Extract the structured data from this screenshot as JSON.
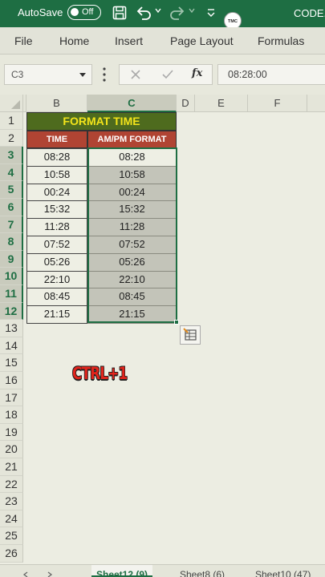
{
  "titlebar": {
    "autosave_label": "AutoSave",
    "autosave_state": "Off",
    "logo_text": "TMC",
    "file_name": "CODE.x"
  },
  "ribbon": {
    "tabs": [
      "File",
      "Home",
      "Insert",
      "Page Layout",
      "Formulas"
    ]
  },
  "formula_bar": {
    "name_box": "C3",
    "fx": "fx",
    "formula": "08:28:00"
  },
  "columns": [
    "B",
    "C",
    "D",
    "E",
    "F"
  ],
  "rows": [
    "1",
    "2",
    "3",
    "4",
    "5",
    "6",
    "7",
    "8",
    "9",
    "10",
    "11",
    "12",
    "13",
    "14",
    "15",
    "16",
    "17",
    "18",
    "19",
    "20",
    "21",
    "22",
    "23",
    "24",
    "25",
    "26"
  ],
  "table": {
    "title": "FORMAT TIME",
    "header_time": "TIME",
    "header_ampm": "AM/PM FORMAT",
    "time_values": [
      "08:28",
      "10:58",
      "00:24",
      "15:32",
      "11:28",
      "07:52",
      "05:26",
      "22:10",
      "08:45",
      "21:15"
    ],
    "ampm_values": [
      "08:28",
      "10:58",
      "00:24",
      "15:32",
      "11:28",
      "07:52",
      "05:26",
      "22:10",
      "08:45",
      "21:15"
    ]
  },
  "overlay": {
    "shortcut": "CTRL+1"
  },
  "sheets": [
    "Sheet12 (9)",
    "Sheet8 (6)",
    "Sheet10 (47)"
  ],
  "colors": {
    "excel_green": "#1e6e43",
    "title_fill": "#4e6b1e",
    "title_text": "#f3e41a",
    "header_fill": "#b04433",
    "selection_fill": "#c3c4b9",
    "shortcut_red": "#e2241c"
  }
}
